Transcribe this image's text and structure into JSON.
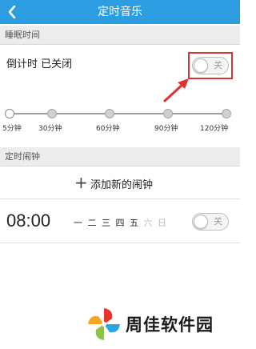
{
  "header": {
    "title": "定时音乐",
    "back_icon": "back-arrow-icon"
  },
  "sleep": {
    "section_title": "睡眠时间",
    "countdown_label": "倒计时 已关闭",
    "toggle_label": "关",
    "toggle_state": "off",
    "slider": {
      "stops": [
        "5分钟",
        "30分钟",
        "60分钟",
        "90分钟",
        "120分钟"
      ],
      "selected_index": 0
    }
  },
  "alarm": {
    "section_title": "定时闹钟",
    "add_label": "添加新的闹钟",
    "add_icon": "plus-icon",
    "items": [
      {
        "time": "08:00",
        "days": [
          {
            "label": "一",
            "active": true
          },
          {
            "label": "二",
            "active": true
          },
          {
            "label": "三",
            "active": true
          },
          {
            "label": "四",
            "active": true
          },
          {
            "label": "五",
            "active": true
          },
          {
            "label": "六",
            "active": false
          },
          {
            "label": "日",
            "active": false
          }
        ],
        "toggle_label": "关",
        "toggle_state": "off"
      }
    ]
  },
  "colors": {
    "title_bar": "#2b9de0",
    "highlight": "#e03131",
    "section_bg": "#ececec"
  },
  "watermark": {
    "text": "周佳软件园"
  }
}
